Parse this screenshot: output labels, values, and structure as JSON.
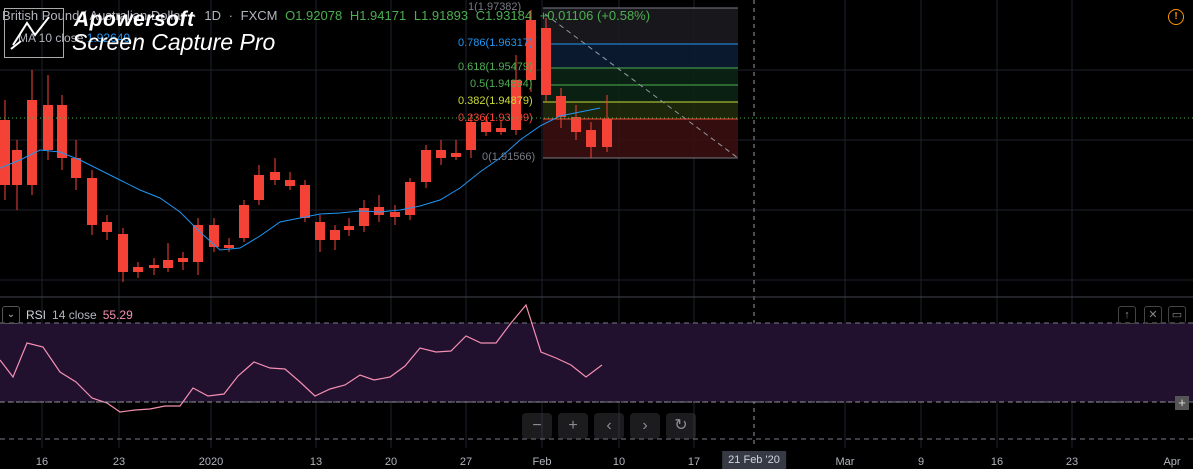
{
  "legend": {
    "symbol": "British Pound / Australian Dollar",
    "interval": "1D",
    "exchange": "FXCM",
    "open": "O1.92078",
    "high": "H1.94171",
    "low": "L1.91893",
    "close": "C1.93184",
    "change": "+0.01106 (+0.58%)"
  },
  "ma": {
    "label": "MA 10 close",
    "value": "1.92640"
  },
  "watermark": {
    "line1": "Apowersoft",
    "line2": "Screen Capture Pro"
  },
  "fib_levels": [
    {
      "label": "1(1.97382)",
      "color": "#787b86"
    },
    {
      "label": "0.786(1.96317)",
      "color": "#2196f3"
    },
    {
      "label": "0.618(1.95479)",
      "color": "#4caf50"
    },
    {
      "label": "0.5(1.94894)",
      "color": "#4caf50"
    },
    {
      "label": "0.382(1.94879)",
      "color": "#cddc39"
    },
    {
      "label": "0.236(1.93599)",
      "color": "#f44336"
    },
    {
      "label": "0(1.91566)",
      "color": "#787b86"
    }
  ],
  "rsi": {
    "name": "RSI",
    "params": "14 close",
    "value": "55.29"
  },
  "time_axis": {
    "ticks": [
      "16",
      "23",
      "2020",
      "13",
      "20",
      "27",
      "Feb",
      "10",
      "17",
      "Mar",
      "9",
      "16",
      "23",
      "Apr"
    ],
    "highlight": "21 Feb '20"
  },
  "nav_buttons": [
    {
      "icon": "minus-icon",
      "glyph": "−"
    },
    {
      "icon": "plus-icon",
      "glyph": "+"
    },
    {
      "icon": "chevron-left-icon",
      "glyph": "‹"
    },
    {
      "icon": "chevron-right-icon",
      "glyph": "›"
    },
    {
      "icon": "reset-icon",
      "glyph": "↻"
    }
  ],
  "colors": {
    "up": "#4caf50",
    "down": "#f44336",
    "ma": "#2196f3",
    "rsi": "#f48fb1",
    "rsi_band": "#21102e"
  }
}
